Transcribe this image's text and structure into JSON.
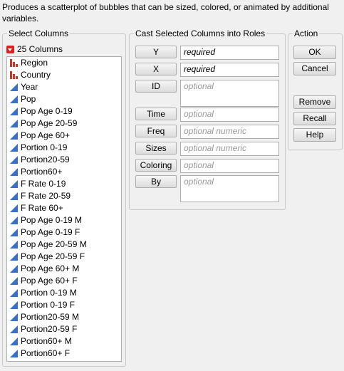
{
  "description": "Produces a scatterplot of bubbles that can be sized, colored, or animated by additional variables.",
  "select_columns": {
    "title": "Select Columns",
    "count_label": "25 Columns",
    "columns": [
      {
        "name": "Region",
        "type": "nominal"
      },
      {
        "name": "Country",
        "type": "nominal"
      },
      {
        "name": "Year",
        "type": "continuous"
      },
      {
        "name": "Pop",
        "type": "continuous"
      },
      {
        "name": "Pop Age 0-19",
        "type": "continuous"
      },
      {
        "name": "Pop Age 20-59",
        "type": "continuous"
      },
      {
        "name": "Pop Age 60+",
        "type": "continuous"
      },
      {
        "name": "Portion 0-19",
        "type": "continuous"
      },
      {
        "name": "Portion20-59",
        "type": "continuous"
      },
      {
        "name": "Portion60+",
        "type": "continuous"
      },
      {
        "name": "F Rate 0-19",
        "type": "continuous"
      },
      {
        "name": "F Rate 20-59",
        "type": "continuous"
      },
      {
        "name": "F Rate 60+",
        "type": "continuous"
      },
      {
        "name": "Pop Age 0-19 M",
        "type": "continuous"
      },
      {
        "name": "Pop Age 0-19 F",
        "type": "continuous"
      },
      {
        "name": "Pop Age 20-59 M",
        "type": "continuous"
      },
      {
        "name": "Pop Age 20-59 F",
        "type": "continuous"
      },
      {
        "name": "Pop Age 60+ M",
        "type": "continuous"
      },
      {
        "name": "Pop Age 60+ F",
        "type": "continuous"
      },
      {
        "name": "Portion 0-19 M",
        "type": "continuous"
      },
      {
        "name": "Portion 0-19 F",
        "type": "continuous"
      },
      {
        "name": "Portion20-59 M",
        "type": "continuous"
      },
      {
        "name": "Portion20-59 F",
        "type": "continuous"
      },
      {
        "name": "Portion60+ M",
        "type": "continuous"
      },
      {
        "name": "Portion60+ F",
        "type": "continuous"
      }
    ]
  },
  "cast": {
    "title": "Cast Selected Columns into Roles",
    "roles": {
      "y": {
        "label": "Y",
        "hint": "required"
      },
      "x": {
        "label": "X",
        "hint": "required"
      },
      "id": {
        "label": "ID",
        "hint": "optional"
      },
      "time": {
        "label": "Time",
        "hint": "optional"
      },
      "freq": {
        "label": "Freq",
        "hint": "optional numeric"
      },
      "sizes": {
        "label": "Sizes",
        "hint": "optional numeric"
      },
      "coloring": {
        "label": "Coloring",
        "hint": "optional"
      },
      "by": {
        "label": "By",
        "hint": "optional"
      }
    }
  },
  "action": {
    "title": "Action",
    "ok": "OK",
    "cancel": "Cancel",
    "remove": "Remove",
    "recall": "Recall",
    "help": "Help"
  },
  "colors": {
    "nominal_icon": "#c0392b",
    "continuous_icon": "#3a6fc9"
  }
}
